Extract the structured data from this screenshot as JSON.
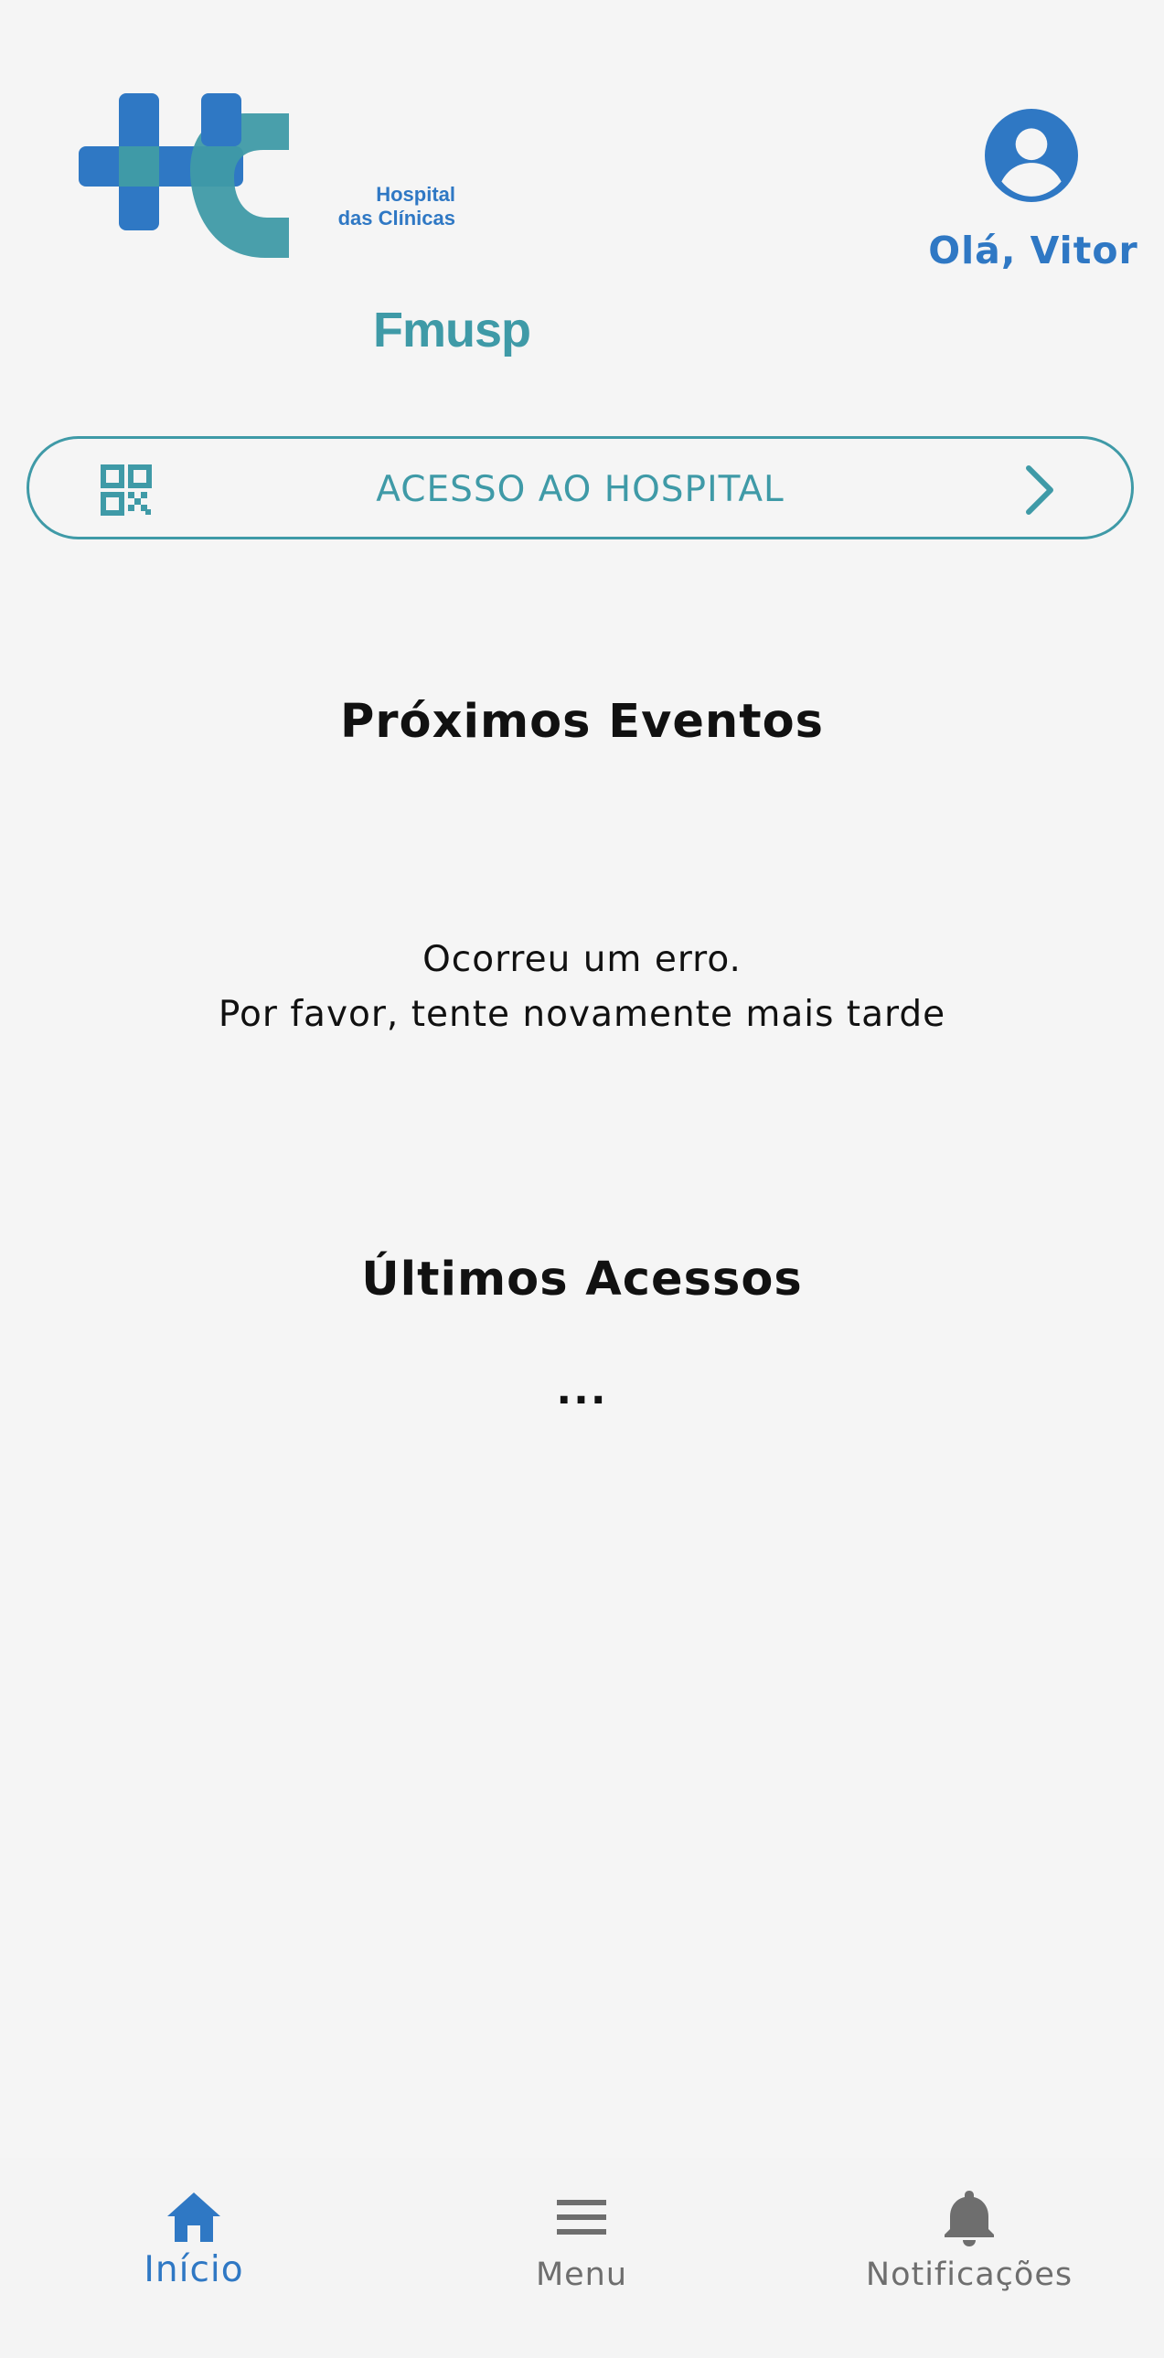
{
  "header": {
    "logo": {
      "line1": "Hospital",
      "line2": "das Clínicas",
      "line3": "Fmusp"
    },
    "greeting": "Olá, Vitor"
  },
  "access_button": {
    "label": "ACESSO AO HOSPITAL",
    "icon_left": "qr-code-icon",
    "icon_right": "chevron-right-icon"
  },
  "events": {
    "title": "Próximos Eventos",
    "error_line1": "Ocorreu um erro.",
    "error_line2": "Por favor, tente novamente mais tarde"
  },
  "accesses": {
    "title": "Últimos Acessos",
    "loading": "..."
  },
  "bottom_nav": {
    "items": [
      {
        "label": "Início",
        "icon": "home-icon",
        "active": true
      },
      {
        "label": "Menu",
        "icon": "menu-icon",
        "active": false
      },
      {
        "label": "Notificações",
        "icon": "bell-icon",
        "active": false
      }
    ]
  },
  "colors": {
    "primary_blue": "#2f78c4",
    "teal": "#3f9aa7",
    "background": "#f5f5f5",
    "inactive": "#6e6e6e"
  }
}
